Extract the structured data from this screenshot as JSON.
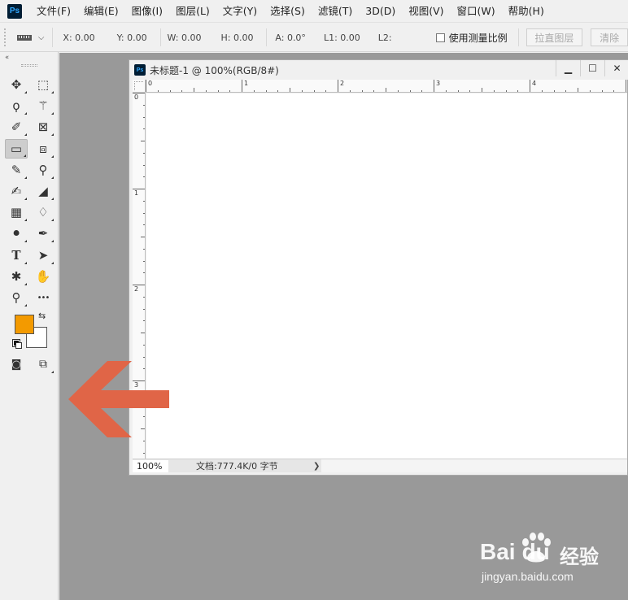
{
  "app": {
    "logo_text": "Ps"
  },
  "menu": {
    "items": [
      "文件(F)",
      "编辑(E)",
      "图像(I)",
      "图层(L)",
      "文字(Y)",
      "选择(S)",
      "滤镜(T)",
      "3D(D)",
      "视图(V)",
      "窗口(W)",
      "帮助(H)"
    ]
  },
  "options": {
    "dropdown_icon": "chevron-down-icon",
    "x": "X: 0.00",
    "y": "Y: 0.00",
    "w": "W: 0.00",
    "h": "H: 0.00",
    "a": "A: 0.0°",
    "l1": "L1: 0.00",
    "l2": "L2:",
    "measure_scale_label": "使用测量比例",
    "straighten_layer_label": "拉直图层",
    "clear_label": "清除"
  },
  "toolbar": {
    "collapse_label": "‹‹",
    "tools": [
      {
        "name": "move-tool",
        "icon": "move-icon",
        "glyph": "✥"
      },
      {
        "name": "marquee-tool",
        "icon": "rect-marquee-icon",
        "glyph": "⬚"
      },
      {
        "name": "lasso-tool",
        "icon": "lasso-icon",
        "glyph": "ϙ"
      },
      {
        "name": "magic-wand-tool",
        "icon": "magic-wand-icon",
        "glyph": "⚚"
      },
      {
        "name": "crop-tool",
        "icon": "crop-icon",
        "glyph": "✐"
      },
      {
        "name": "frame-tool",
        "icon": "frame-icon",
        "glyph": "⊠"
      },
      {
        "name": "ruler-tool",
        "icon": "ruler-icon",
        "glyph": "▭"
      },
      {
        "name": "patch-tool",
        "icon": "patch-icon",
        "glyph": "⧈"
      },
      {
        "name": "brush-tool",
        "icon": "brush-icon",
        "glyph": "✎"
      },
      {
        "name": "stamp-tool",
        "icon": "stamp-icon",
        "glyph": "⚲"
      },
      {
        "name": "history-brush-tool",
        "icon": "history-brush-icon",
        "glyph": "✍"
      },
      {
        "name": "eraser-tool",
        "icon": "eraser-icon",
        "glyph": "◢"
      },
      {
        "name": "gradient-tool",
        "icon": "gradient-icon",
        "glyph": "▦"
      },
      {
        "name": "blur-tool",
        "icon": "drop-icon",
        "glyph": "♢"
      },
      {
        "name": "dodge-tool",
        "icon": "dodge-icon",
        "glyph": "⚫"
      },
      {
        "name": "pen-tool",
        "icon": "pen-icon",
        "glyph": "✒"
      },
      {
        "name": "type-tool",
        "icon": "type-icon",
        "glyph": "T"
      },
      {
        "name": "path-select-tool",
        "icon": "arrow-icon",
        "glyph": "➤"
      },
      {
        "name": "shape-tool",
        "icon": "shape-icon",
        "glyph": "✱"
      },
      {
        "name": "hand-tool",
        "icon": "hand-icon",
        "glyph": "✋"
      },
      {
        "name": "zoom-tool",
        "icon": "magnifier-icon",
        "glyph": "⚲"
      },
      {
        "name": "more-tools",
        "icon": "ellipsis-icon",
        "glyph": "•••"
      }
    ],
    "foreground_color": "#f39a00",
    "background_color": "#ffffff",
    "swap_glyph": "⇆",
    "quickmask_glyph": "◙",
    "screenmode_glyph": "⧉"
  },
  "document": {
    "title": "未标题-1 @ 100%(RGB/8#)",
    "minimize_label": "▁",
    "maximize_label": "☐",
    "close_label": "✕",
    "ruler_h_labels": [
      "0",
      "1",
      "2",
      "3",
      "4"
    ],
    "ruler_v_labels": [
      "0",
      "1",
      "2",
      "3"
    ],
    "zoom": "100%",
    "doc_info": "文档:777.4K/0 字节",
    "status_arrow": "❯"
  },
  "colors": {
    "accent_arrow": "#e06547",
    "workspace": "#999999"
  },
  "watermark": {
    "brand": "Bai",
    "brand_tail": "du",
    "experience": "经验",
    "url": "jingyan.baidu.com"
  }
}
